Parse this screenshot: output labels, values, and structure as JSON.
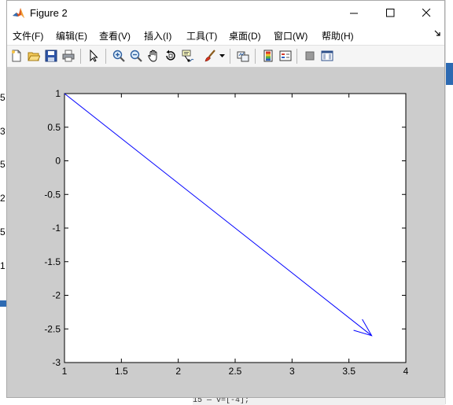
{
  "window": {
    "title": "Figure 2"
  },
  "menu": [
    {
      "label": "文件(F)"
    },
    {
      "label": "编辑(E)"
    },
    {
      "label": "查看(V)"
    },
    {
      "label": "插入(I)"
    },
    {
      "label": "工具(T)"
    },
    {
      "label": "桌面(D)"
    },
    {
      "label": "窗口(W)"
    },
    {
      "label": "帮助(H)"
    }
  ],
  "toolbar": [
    {
      "icon": "new-figure-icon"
    },
    {
      "icon": "open-file-icon"
    },
    {
      "icon": "save-icon"
    },
    {
      "icon": "print-icon"
    },
    {
      "icon": "edit-plot-arrow-icon"
    },
    {
      "icon": "zoom-in-icon"
    },
    {
      "icon": "zoom-out-icon"
    },
    {
      "icon": "pan-hand-icon"
    },
    {
      "icon": "rotate-3d-icon"
    },
    {
      "icon": "data-cursor-icon"
    },
    {
      "icon": "brush-icon"
    },
    {
      "icon": "link-plot-icon"
    },
    {
      "icon": "colorbar-icon"
    },
    {
      "icon": "legend-icon"
    },
    {
      "icon": "hide-plot-tools-icon"
    },
    {
      "icon": "show-plot-tools-icon"
    }
  ],
  "background": {
    "left_fragments": [
      "5",
      "3",
      "5",
      "2",
      "5",
      "1"
    ],
    "bottom_text": "15 —    v=[-4];"
  },
  "colors": {
    "plot_line": "#0000ff",
    "figure_bg": "#cccccc",
    "axes_bg": "#ffffff"
  },
  "chart_data": {
    "type": "line",
    "xlim": [
      1,
      4
    ],
    "ylim": [
      -3,
      1
    ],
    "xticks": [
      "1",
      "1.5",
      "2",
      "2.5",
      "3",
      "3.5",
      "4"
    ],
    "yticks": [
      "1",
      "0.5",
      "0",
      "-0.5",
      "-1",
      "-1.5",
      "-2",
      "-2.5",
      "-3"
    ],
    "series": [
      {
        "x": [
          1,
          3.7
        ],
        "y": [
          1,
          -2.6
        ],
        "arrowhead": true,
        "color": "#0000ff"
      }
    ],
    "grid": false
  }
}
